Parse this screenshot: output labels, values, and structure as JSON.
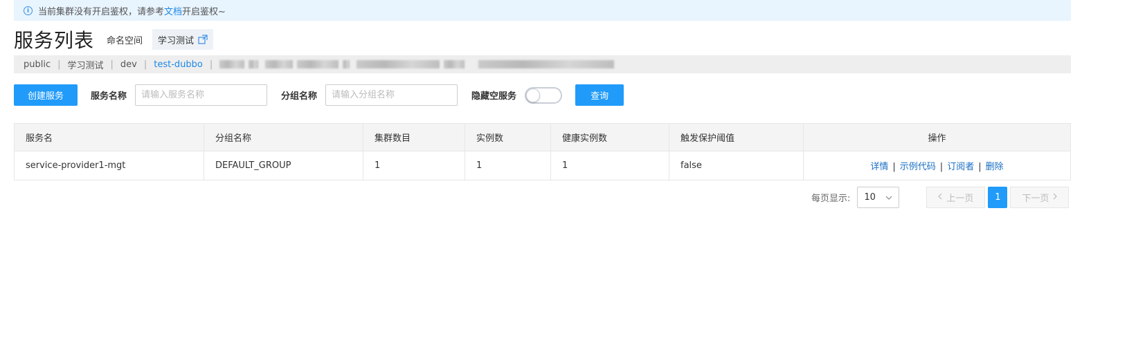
{
  "notice": {
    "text_before": "当前集群没有开启鉴权，请参考",
    "link": "文档",
    "text_after": "开启鉴权~"
  },
  "header": {
    "title": "服务列表",
    "namespace_label": "命名空间",
    "namespace_current": "学习测试"
  },
  "namespaces": [
    "public",
    "学习测试",
    "dev",
    "test-dubbo"
  ],
  "toolbar": {
    "create_button": "创建服务",
    "service_name_label": "服务名称",
    "service_name_placeholder": "请输入服务名称",
    "group_name_label": "分组名称",
    "group_name_placeholder": "请输入分组名称",
    "hide_empty_label": "隐藏空服务",
    "query_button": "查询"
  },
  "table": {
    "columns": [
      "服务名",
      "分组名称",
      "集群数目",
      "实例数",
      "健康实例数",
      "触发保护阈值",
      "操作"
    ],
    "rows": [
      {
        "service": "service-provider1-mgt",
        "group": "DEFAULT_GROUP",
        "clusters": "1",
        "instances": "1",
        "healthy": "1",
        "threshold": "false"
      }
    ],
    "actions": [
      "详情",
      "示例代码",
      "订阅者",
      "删除"
    ],
    "action_sep": "|"
  },
  "pagination": {
    "page_size_label": "每页显示:",
    "page_size": "10",
    "prev": "上一页",
    "current_page": "1",
    "next": "下一页"
  },
  "colors": {
    "primary": "#209bfa",
    "link": "#1a6fc2",
    "notice_bg": "#e8f4fe"
  }
}
